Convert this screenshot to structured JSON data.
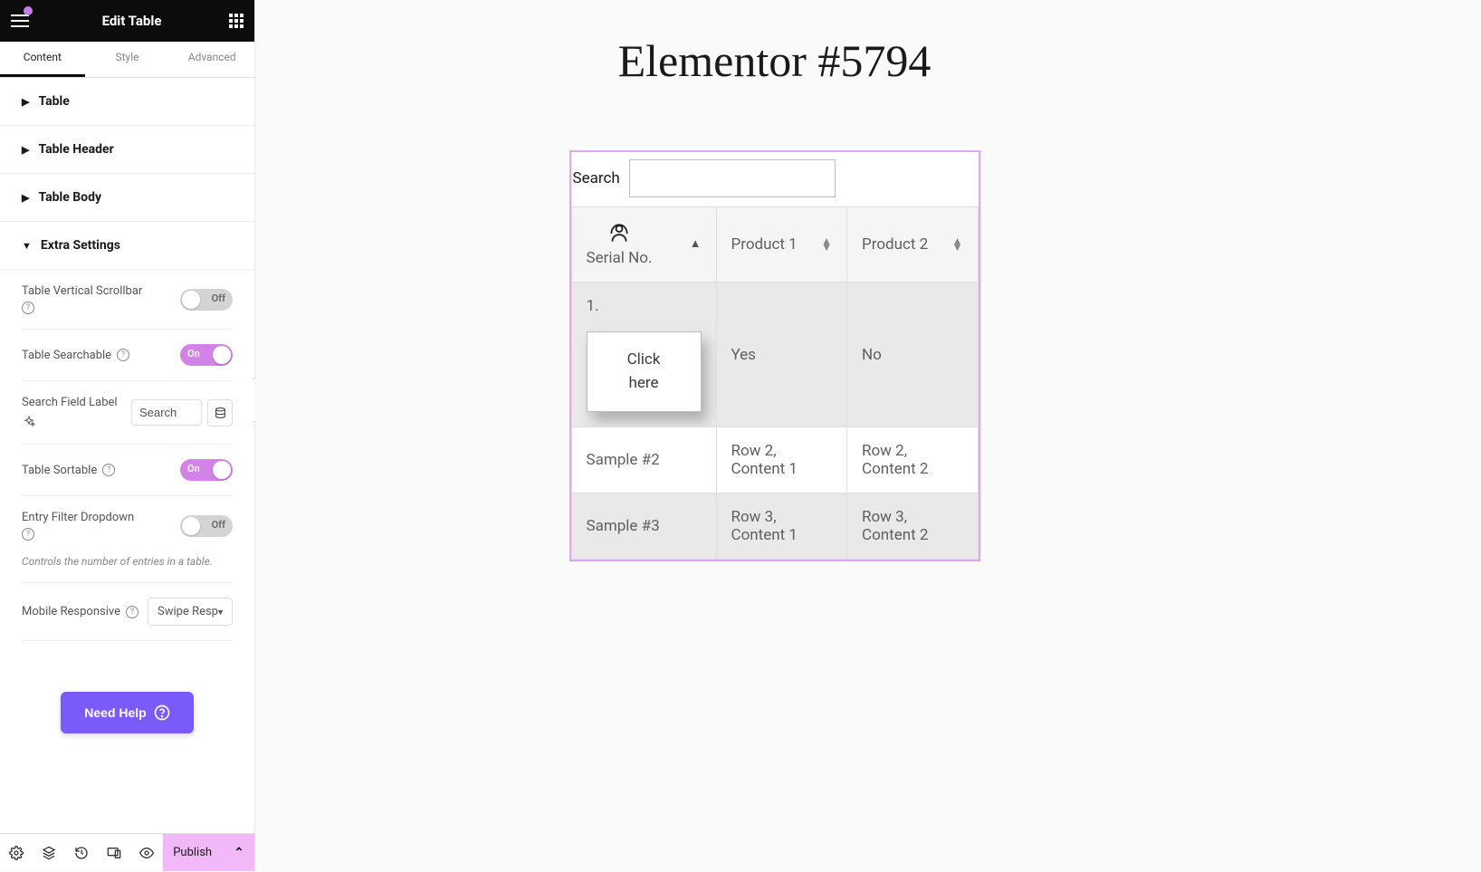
{
  "topbar": {
    "title": "Edit Table"
  },
  "tabs": {
    "content": "Content",
    "style": "Style",
    "advanced": "Advanced"
  },
  "sections": {
    "table": "Table",
    "table_header": "Table Header",
    "table_body": "Table Body",
    "extra_settings": "Extra Settings"
  },
  "controls": {
    "vertical_scrollbar": {
      "label": "Table Vertical Scrollbar",
      "state": "Off"
    },
    "searchable": {
      "label": "Table Searchable",
      "state": "On"
    },
    "search_field_label": {
      "label": "Search Field Label",
      "value": "Search"
    },
    "sortable": {
      "label": "Table Sortable",
      "state": "On"
    },
    "entry_filter": {
      "label": "Entry Filter Dropdown",
      "state": "Off",
      "hint": "Controls the number of entries in a table."
    },
    "mobile_responsive": {
      "label": "Mobile Responsive",
      "value": "Swipe Resp"
    }
  },
  "need_help": "Need Help",
  "publish": "Publish",
  "page": {
    "title": "Elementor #5794"
  },
  "table": {
    "search_label": "Search",
    "headers": [
      "Serial No.",
      "Product 1",
      "Product 2"
    ],
    "rows": [
      {
        "c0_top": "1.",
        "c0_btn": "Click here",
        "c1": "Yes",
        "c2": "No"
      },
      {
        "c0": "Sample #2",
        "c1": "Row 2, Content 1",
        "c2": "Row 2, Content 2"
      },
      {
        "c0": "Sample #3",
        "c1": "Row 3, Content 1",
        "c2": "Row 3, Content 2"
      }
    ]
  }
}
